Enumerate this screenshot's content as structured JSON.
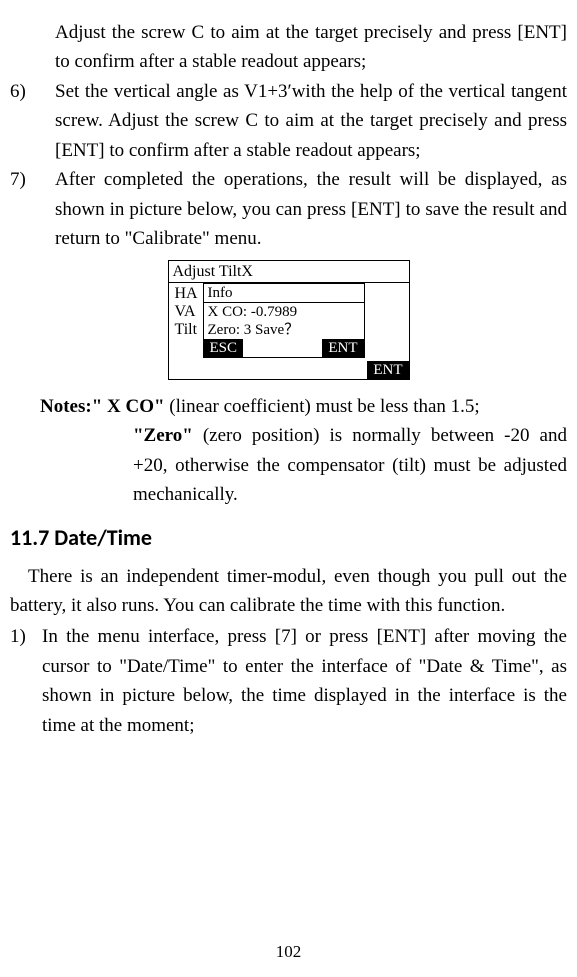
{
  "body": {
    "p5_cont": "Adjust the screw C to aim at the target precisely and press [ENT] to confirm after a stable readout appears;",
    "n6": "6)",
    "p6": "Set the vertical angle as V1+3′with the help of the vertical tangent screw. Adjust the screw C to aim at the target precisely and press [ENT] to confirm after a stable readout appears;",
    "n7": "7)",
    "p7": "After completed the operations, the result will be displayed, as shown in picture below, you can press [ENT] to save the result and return to \"Calibrate\" menu."
  },
  "device": {
    "title": "Adjust TiltX",
    "row1": "HA",
    "row2": "VA",
    "row3": "Tilt",
    "popup": {
      "title": "Info",
      "l1": "X CO: -0.7989",
      "l2": "Zero: 3   Save？",
      "esc": "ESC",
      "ent": "ENT"
    },
    "ent_outer": "ENT"
  },
  "notes": {
    "label": "Notes: ",
    "xco_label": "\" X CO\"",
    "xco_text": " (linear coefficient) must be less than 1.5;",
    "zero_label": "\"Zero\"",
    "zero_text": " (zero position) is normally between -20 and +20, otherwise the compensator (tilt) must be adjusted mechanically."
  },
  "section_heading": "11.7 Date/Time",
  "intro": "There is an independent timer-modul, even though you pull out the battery, it also runs. You can calibrate the time with this function.",
  "step1": {
    "num": "1)",
    "text": "In the menu interface, press [7] or press [ENT] after moving the cursor to \"Date/Time\" to enter the interface of \"Date & Time\", as shown in picture below, the time displayed in the interface is the time at the moment;"
  },
  "page_number": "102"
}
